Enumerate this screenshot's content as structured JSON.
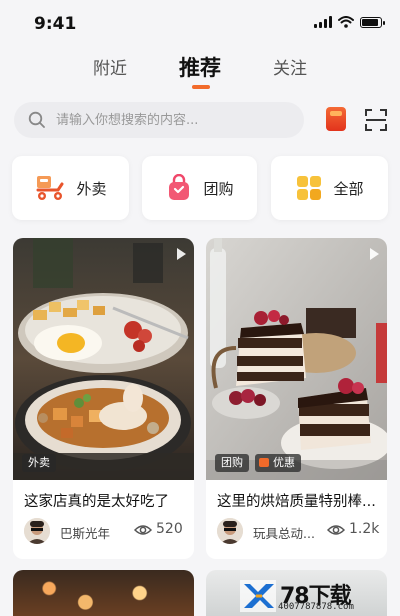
{
  "status_bar": {
    "time": "9:41"
  },
  "tabs": [
    {
      "label": "附近",
      "active": false
    },
    {
      "label": "推荐",
      "active": true
    },
    {
      "label": "关注",
      "active": false
    }
  ],
  "search": {
    "placeholder": "请输入你想搜索的内容..."
  },
  "categories": [
    {
      "label": "外卖",
      "icon": "scooter-icon"
    },
    {
      "label": "团购",
      "icon": "shopping-bag-icon"
    },
    {
      "label": "全部",
      "icon": "grid-icon"
    }
  ],
  "feed": [
    {
      "tags": [
        "外卖"
      ],
      "title": "这家店真的是太好吃了",
      "author": "巴斯光年",
      "views": "520"
    },
    {
      "tags": [
        "团购",
        "优惠"
      ],
      "title": "这里的烘焙质量特别棒...",
      "author": "玩具总动...",
      "views": "1.2k"
    }
  ],
  "watermark": {
    "title": "78下载",
    "url": "4007787878.com"
  },
  "colors": {
    "accent": "#f26b2b",
    "background": "#f5f5f7"
  }
}
